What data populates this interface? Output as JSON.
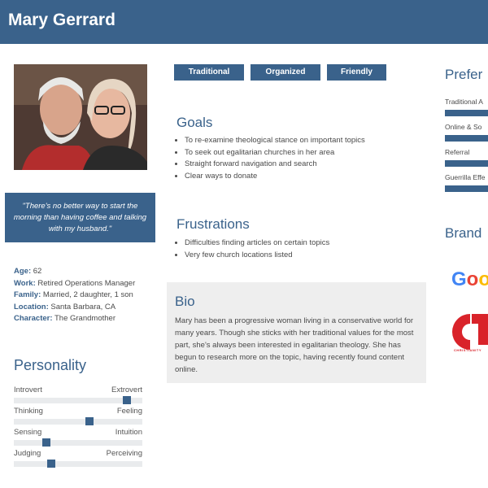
{
  "header": {
    "name": "Mary Gerrard"
  },
  "quote": "\"There's no better way to start the morning than having coffee and talking with my husband.\"",
  "facts": [
    {
      "label": "Age:",
      "value": " 62"
    },
    {
      "label": "Work:",
      "value": " Retired Operations Manager"
    },
    {
      "label": "Family:",
      "value": " Married, 2 daughter, 1 son"
    },
    {
      "label": "Location:",
      "value": " Santa Barbara, CA"
    },
    {
      "label": "Character:",
      "value": " The Grandmother"
    }
  ],
  "personality": {
    "title": "Personality",
    "traits": [
      {
        "left": "Introvert",
        "right": "Extrovert",
        "level": 0.88
      },
      {
        "left": "Thinking",
        "right": "Feeling",
        "level": 0.59
      },
      {
        "left": "Sensing",
        "right": "Intuition",
        "level": 0.25
      },
      {
        "left": "Judging",
        "right": "Perceiving",
        "level": 0.29
      }
    ]
  },
  "tags": [
    "Traditional",
    "Organized",
    "Friendly"
  ],
  "goals": {
    "title": "Goals",
    "items": [
      "To re-examine theological stance on important topics",
      "To seek out egalitarian churches in her area",
      "Straight forward navigation and search",
      "Clear ways to donate"
    ]
  },
  "frustrations": {
    "title": "Frustrations",
    "items": [
      "Difficulties finding articles on certain topics",
      "Very few church locations listed"
    ]
  },
  "bio": {
    "title": "Bio",
    "text": "Mary has been a progressive woman living in a conservative world for many years. Though she sticks with her traditional values for the most part, she's always been interested in egalitarian theology. She has begun to research more on the topic, having recently found content online."
  },
  "preferred": {
    "title": "Prefer",
    "items": [
      "Traditional A",
      "Online & So",
      "Referral",
      "Guerrilla Effe"
    ]
  },
  "brands": {
    "title": "Brand",
    "google_partial": "Goo",
    "ct_partial": "CT",
    "ct_caption": "CHRISTIANITY"
  },
  "colors": {
    "accent": "#3a628b",
    "bio_bg": "#eeeeee",
    "track": "#e9ebed"
  }
}
